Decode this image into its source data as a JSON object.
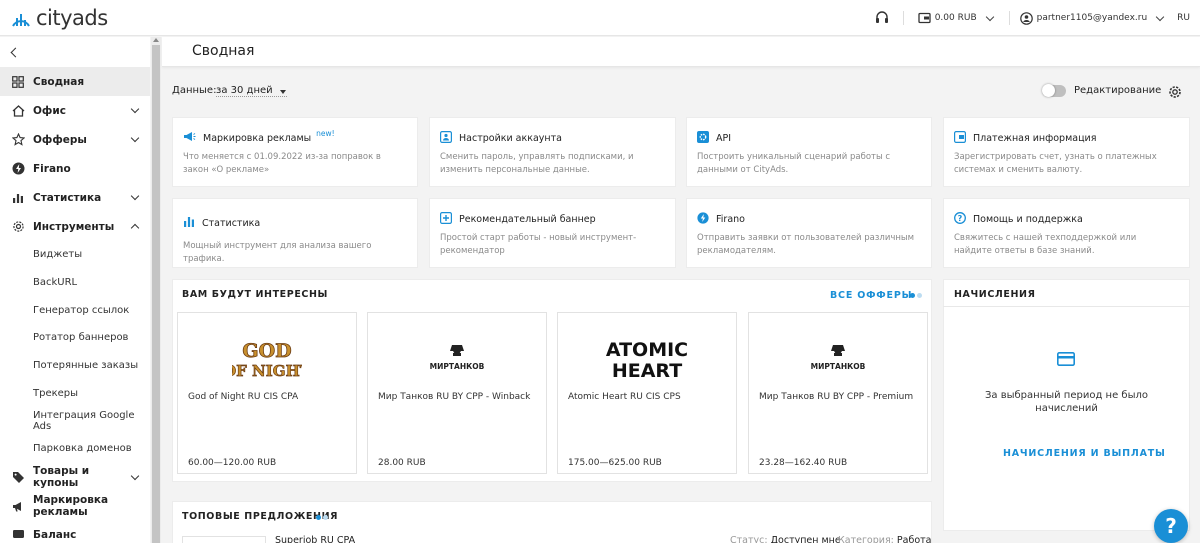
{
  "header": {
    "logo_text": "cityads",
    "balance": "0.00 RUB",
    "user": "partner1105@yandex.ru",
    "lang": "RU"
  },
  "sidebar": {
    "items": [
      {
        "label": "Сводная",
        "icon": "grid-icon"
      },
      {
        "label": "Офис",
        "icon": "home-icon"
      },
      {
        "label": "Офферы",
        "icon": "star-icon"
      },
      {
        "label": "Firano",
        "icon": "lightning-icon"
      },
      {
        "label": "Статистика",
        "icon": "bar-chart-icon"
      },
      {
        "label": "Инструменты",
        "icon": "gear-icon"
      },
      {
        "label": "Товары и купоны",
        "icon": "tag-icon"
      },
      {
        "label": "Маркировка рекламы",
        "icon": "megaphone-icon"
      },
      {
        "label": "Баланс"
      }
    ],
    "tools_sub": [
      "Виджеты",
      "BackURL",
      "Генератор ссылок",
      "Ротатор баннеров",
      "Потерянные заказы",
      "Трекеры",
      "Интеграция Google Ads",
      "Парковка доменов"
    ]
  },
  "page": {
    "title": "Сводная",
    "filter_label": "Данные:",
    "filter_value": "за 30 дней",
    "edit_label": "Редактирование"
  },
  "cards": [
    {
      "title": "Маркировка рекламы",
      "new": "new!",
      "desc": "Что меняется с 01.09.2022 из-за поправок в закон «О рекламе»",
      "icon": "megaphone-icon"
    },
    {
      "title": "Настройки аккаунта",
      "desc": "Сменить пароль, управлять подписками, и изменить персональные данные.",
      "icon": "user-settings-icon"
    },
    {
      "title": "API",
      "desc": "Построить уникальный сценарий работы с данными от CityAds.",
      "icon": "gear-square-icon"
    },
    {
      "title": "Платежная информация",
      "desc": "Зарегистрировать счет, узнать о платежных системах и сменить валюту.",
      "icon": "wallet-icon"
    },
    {
      "title": "Статистика",
      "desc": "Мощный инструмент для анализа вашего трафика.",
      "icon": "bar-chart-icon"
    },
    {
      "title": "Рекомендательный баннер",
      "desc": "Простой старт работы - новый инструмент-рекомендатор",
      "icon": "plus-square-icon"
    },
    {
      "title": "Firano",
      "desc": "Отправить заявки от пользователей различным рекламодателям.",
      "icon": "lightning-icon"
    },
    {
      "title": "Помощь и поддержка",
      "desc": "Свяжитесь с нашей техподдержкой или найдите ответы в базе знаний.",
      "icon": "question-icon"
    }
  ],
  "interesting": {
    "title": "ВАМ БУДУТ ИНТЕРЕСНЫ",
    "all_label": "ВСЕ ОФФЕРЫ",
    "offers": [
      {
        "logo": "GOD\nOF NIGHT",
        "name": "God of Night RU CIS CPA",
        "price": "60.00—120.00 RUB"
      },
      {
        "logo": "МИРТАНКОВ",
        "name": "Мир Танков RU BY CPP - Winback",
        "price": "28.00 RUB"
      },
      {
        "logo": "ATOMIC\nHEART",
        "name": "Atomic Heart RU CIS CPS",
        "price": "175.00—625.00 RUB"
      },
      {
        "logo": "МИРТАНКОВ",
        "name": "Мир Танков RU BY CPP - Premium",
        "price": "23.28—162.40 RUB"
      }
    ]
  },
  "charges": {
    "title": "НАЧИСЛЕНИЯ",
    "empty_text": "За выбранный период не было начислений",
    "link": "НАЧИСЛЕНИЯ И ВЫПЛАТЫ"
  },
  "top_offers": {
    "title": "ТОПОВЫЕ ПРЕДЛОЖЕНИЯ",
    "row_name": "Superjob RU CPA",
    "status_label": "Статус:",
    "status_value": "Доступен мне",
    "category_label": "Категория:",
    "category_value": "Работа"
  },
  "help_button": "?",
  "colors": {
    "accent": "#1a8fd6",
    "logo_blue": "#1a8fd6"
  }
}
